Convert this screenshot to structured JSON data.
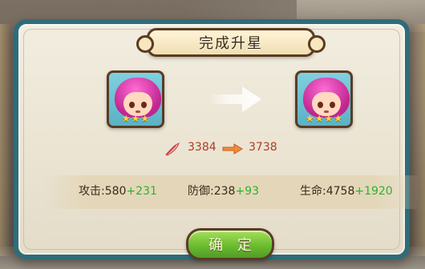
{
  "dialog": {
    "title": "完成升星",
    "confirm_label": "确 定"
  },
  "hero": {
    "before_stars": 3,
    "after_stars": 4,
    "power_before": "3384",
    "power_after": "3738",
    "icons": {
      "before": "hero-portrait-icon",
      "after": "hero-portrait-icon",
      "star": "star-icon",
      "power": "power-feather-icon",
      "arrow": "right-arrow-icon"
    }
  },
  "stats": {
    "attack": {
      "label": "攻击:",
      "base": "580",
      "bonus": "+231"
    },
    "defense": {
      "label": "防御:",
      "base": "238",
      "bonus": "+93"
    },
    "life": {
      "label": "生命:",
      "base": "4758",
      "bonus": "+1920"
    }
  },
  "colors": {
    "frame": "#2f6c79",
    "panel": "#ebe4d3",
    "power_text": "#b03c22",
    "bonus_text": "#2fb12e",
    "confirm_button": "#6cbd2f"
  }
}
